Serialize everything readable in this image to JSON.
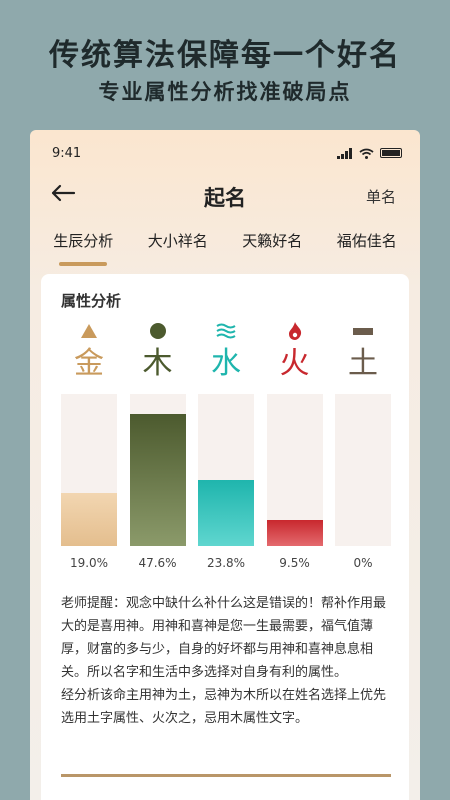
{
  "banner": {
    "headline": "传统算法保障每一个好名",
    "subline": "专业属性分析找准破局点"
  },
  "status_bar": {
    "time": "9:41"
  },
  "navbar": {
    "title": "起名",
    "right_label": "单名",
    "back_icon": "arrow-left-icon"
  },
  "tabs": [
    {
      "label": "生辰分析",
      "active": true
    },
    {
      "label": "大小祥名",
      "active": false
    },
    {
      "label": "天籁好名",
      "active": false
    },
    {
      "label": "福佑佳名",
      "active": false
    }
  ],
  "analysis": {
    "title": "属性分析",
    "elements": [
      {
        "char": "金",
        "icon": "triangle-icon",
        "color": "#c99a5c",
        "percent": 19.0,
        "label": "19.0%"
      },
      {
        "char": "木",
        "icon": "circle-icon",
        "color": "#4c5a2e",
        "percent": 47.6,
        "label": "47.6%"
      },
      {
        "char": "水",
        "icon": "waves-icon",
        "color": "#1fb5ad",
        "percent": 23.8,
        "label": "23.8%"
      },
      {
        "char": "火",
        "icon": "flame-icon",
        "color": "#c8282e",
        "percent": 9.5,
        "label": "9.5%"
      },
      {
        "char": "土",
        "icon": "bar-icon",
        "color": "#6b5c4c",
        "percent": 0,
        "label": "0%"
      }
    ],
    "tip_1": "老师提醒：观念中缺什么补什么这是错误的！帮补作用最大的是喜用神。用神和喜神是您一生最需要，福气值薄厚，财富的多与少，自身的好坏都与用神和喜神息息相关。所以名字和生活中多选择对自身有利的属性。",
    "tip_2": "经分析该命主用神为土，忌神为木所以在姓名选择上优先选用土字属性、火次之，忌用木属性文字。"
  }
}
